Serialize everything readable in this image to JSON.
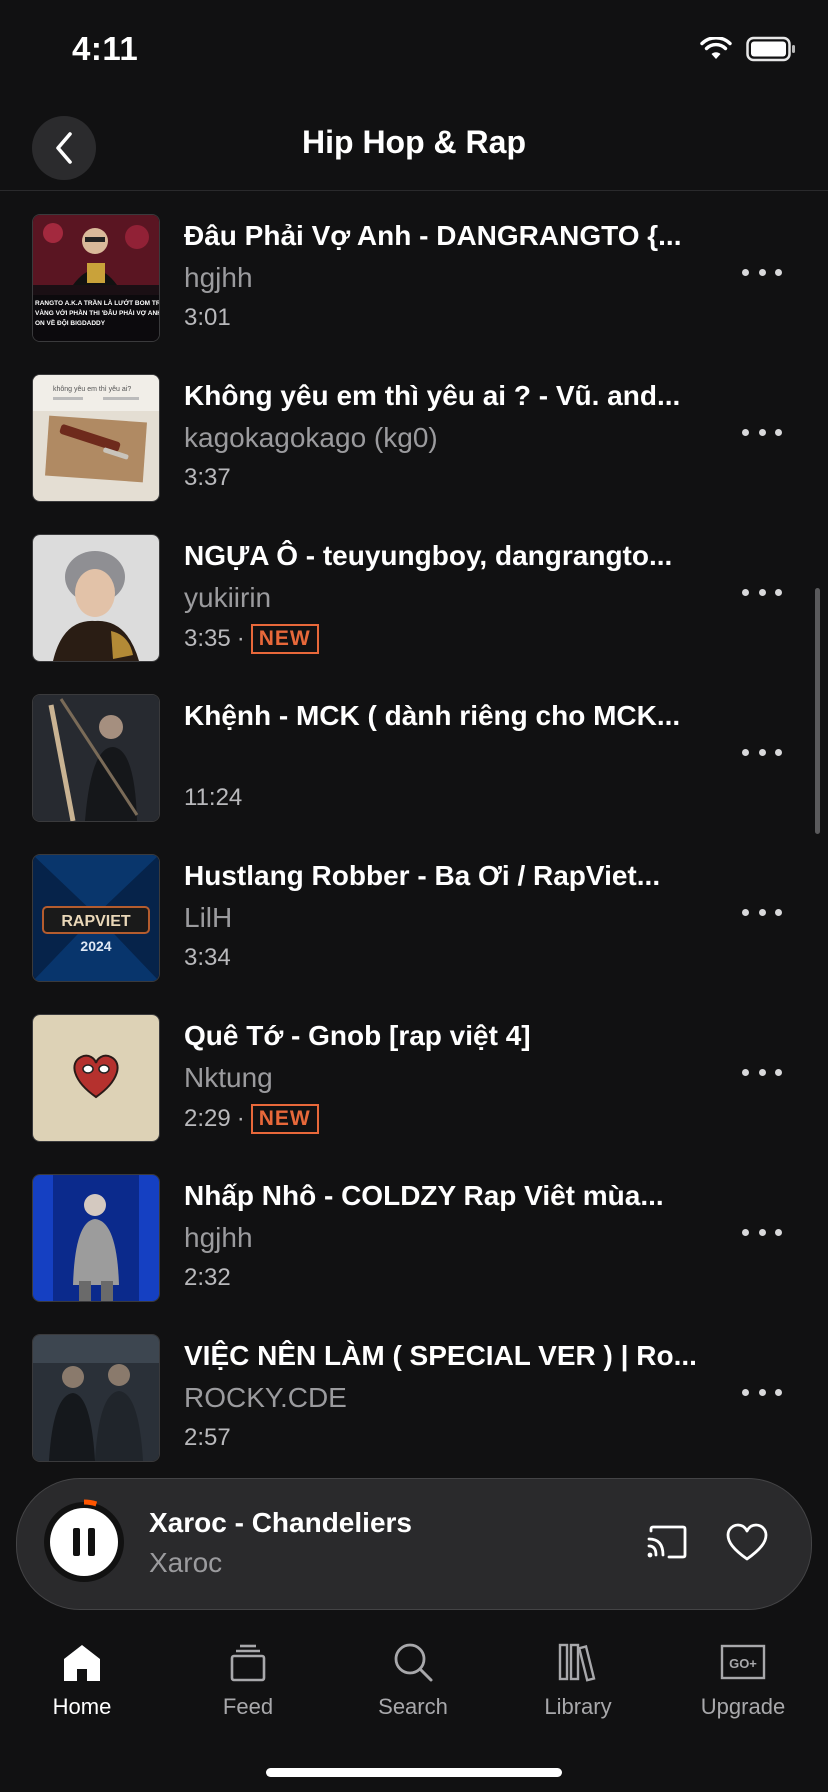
{
  "status_bar": {
    "time": "4:11"
  },
  "header": {
    "title": "Hip Hop & Rap"
  },
  "tracks": [
    {
      "title": "Đâu Phải Vợ Anh - DANGRANGTO {...",
      "user": "hgjhh",
      "duration": "3:01",
      "badge": ""
    },
    {
      "title": "Không yêu em thì yêu ai ? - Vũ. and...",
      "user": "kagokagokago (kg0)",
      "duration": "3:37",
      "badge": ""
    },
    {
      "title": "NGỰA Ô - teuyungboy, dangrangto...",
      "user": "yukiirin",
      "duration": "3:35",
      "badge": "NEW"
    },
    {
      "title": "Khệnh - MCK ( dành riêng cho MCK...",
      "user": "",
      "duration": "11:24",
      "badge": ""
    },
    {
      "title": "Hustlang Robber - Ba Ơi / RapViet...",
      "user": "LilH",
      "duration": "3:34",
      "badge": ""
    },
    {
      "title": "Quê Tớ - Gnob [rap việt 4]",
      "user": "Nktung",
      "duration": "2:29",
      "badge": "NEW"
    },
    {
      "title": "Nhấp Nhô - COLDZY Rap Viêt mùa...",
      "user": "hgjhh",
      "duration": "2:32",
      "badge": ""
    },
    {
      "title": "VIỆC NÊN LÀM ( SPECIAL VER ) | Ro...",
      "user": "ROCKY.CDE",
      "duration": "2:57",
      "badge": ""
    }
  ],
  "thumb_texts": {
    "t0": [
      "RANGTO A.K.A TRẦN LÀ LƯỚT BOM TRỌN",
      "VÀNG VỚI PHẦN THI 'ĐÂU PHẢI VỢ ANH'",
      "ON VỀ ĐỘI BIGDADDY"
    ],
    "t1": "không yêu em thì yêu ai?",
    "t4_top": "RAPVIET",
    "t4_year": "2024"
  },
  "now_playing": {
    "title": "Xaroc - Chandeliers",
    "artist": "Xaroc",
    "progress": 0.05
  },
  "tabs": [
    {
      "label": "Home"
    },
    {
      "label": "Feed"
    },
    {
      "label": "Search"
    },
    {
      "label": "Library"
    },
    {
      "label": "Upgrade"
    }
  ],
  "upgrade_icon_text": "GO+",
  "colors": {
    "accent": "#e8683a",
    "background": "#111112",
    "secondary_text": "#9b9b9e"
  }
}
